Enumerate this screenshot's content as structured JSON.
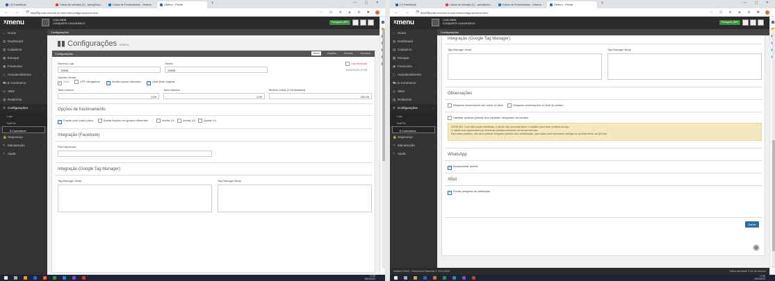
{
  "browser": {
    "tabs": [
      {
        "label": "(7) Facebook",
        "color": "#3b5998"
      },
      {
        "label": "Caixa de entrada (7) - adm@nuv...",
        "color": "#d44638"
      },
      {
        "label": "Caixa de Ferramentas - Xmenu",
        "color": "#2b6cb0"
      },
      {
        "label": "XMenu - Portal",
        "color": "#2b6cb0"
      }
    ],
    "url": "https://portal.netcontroll.com.br/#/configuracoes/xmenu",
    "window_controls": "— ▢ ✕",
    "nav_buttons": "← → ⟳ ⌂"
  },
  "header": {
    "logo_x": "X",
    "logo_text": "menu",
    "store_line1": "LOJA 19838",
    "store_line2": "CONQUISTE LOJA MODELO",
    "language": "Português (BR)"
  },
  "sidebar": {
    "items": [
      {
        "icon": "⌂",
        "label": "Home"
      },
      {
        "icon": "▥",
        "label": "Dashboard"
      },
      {
        "icon": "▤",
        "label": "Cadastros"
      },
      {
        "icon": "▦",
        "label": "Estoque"
      },
      {
        "icon": "▣",
        "label": "Financeiro"
      },
      {
        "icon": "◻",
        "label": "Autoatendimento"
      },
      {
        "icon": "⛟",
        "label": "E-Commerce"
      },
      {
        "icon": "◎",
        "label": "XBot"
      },
      {
        "icon": "▧",
        "label": "Relatórios"
      },
      {
        "icon": "⚙",
        "label": "Configurações"
      }
    ],
    "sub_items": [
      "Loja",
      "NotFiIs",
      "E-Commerce"
    ],
    "bottom_items": [
      {
        "icon": "🔒",
        "label": "Segurança"
      },
      {
        "icon": "✎",
        "label": "Manutenção"
      },
      {
        "icon": "?",
        "label": "Ajuda"
      }
    ]
  },
  "section_header": "Configurações",
  "left": {
    "page_title": "Configurações",
    "page_subtitle": "XMenu",
    "panel_title": "Configurações",
    "panel_tabs": [
      "Geral",
      "Opções",
      "Vendas",
      "Horários"
    ],
    "numero_loja_label": "Número Loja",
    "numero_loja_value": "19838",
    "senha_label": "Senha",
    "senha_value": "19838",
    "loja_fechada_label": "Loja fechada",
    "loja_fechada_date": "10/01/2018 10:58",
    "opcoes_venda_label": "Opções Venda",
    "cb_todo": "Todo",
    "cb_cpf": "CPF Obrigatório",
    "cb_cupom": "Aceita cupom desconto",
    "cb_texto": "Usar texto original",
    "taxa_minima_label": "Taxa mínima",
    "taxa_minima_value": "0.00",
    "taxa_maxima_label": "Taxa máxima",
    "taxa_maxima_value": "0.00",
    "minimo_label": "Mínimo online (0.00 ilimitado)",
    "minimo_value": "200.00",
    "fracionamento_title": "Opções de fracionamento",
    "cb_fracao": "Fração pelo maior preço",
    "cb_grupos": "Aceita frações em grupos diferentes",
    "cb_12": "Aceita 1/2",
    "cb_13": "Aceita 1/3",
    "cb_14": "Aceita 1/4",
    "facebook_title": "Integração (Facebook)",
    "pixel_label": "Pixel facebook",
    "gtm_title": "Integração (Google Tag Manager)",
    "gtm_head_label": "Tag Manager Head",
    "gtm_body_label": "Tag Manager Body"
  },
  "right": {
    "gtm_title": "Integração (Google Tag Manager)",
    "gtm_head_label": "Tag Manager Head",
    "gtm_body_label": "Tag Manager Body",
    "obs_title": "Observações",
    "cb_obs_item": "Disquear observações em todos os itens",
    "cb_obs_final": "Disquear observações no final do pedido",
    "cb_habilitar": "Habilitar pedidos (Mesa) sem cadastro obrigatório do usuário",
    "warn_line1": "ATENÇÃO: Com esta opção habilitada, o cliente não precisará fazer o cadastro para fazer pedidos na loja.",
    "warn_line2": "O lojista será responsável por eventuais pedidos efetuados de forma indevida.",
    "warn_line3": "Para estes pedidos, não será possível bloquear pedidos sem identificação, para estes será necessário desligar os pedidos feitos via QrCode.",
    "whatsapp_title": "WhatsApp",
    "cb_acompanhar": "Acompanhar pedido",
    "xbot_title": "XBot",
    "cb_pesquisa": "Enviar pesquisa de satisfação",
    "save_label": "Salvar",
    "footer_left": "NetMet ©2003 - Netcontroll Sistemas © 2012-2023",
    "footer_right": "Última atividade © há 28 minutos"
  },
  "taskbar": {
    "time": "17:40",
    "date": "15/01/2023",
    "lang": "POR PTB2"
  },
  "colors": {
    "accent": "#2b6cb0",
    "header_bg": "#2b2b2b",
    "sidebar_bg": "#333333",
    "lang_green": "#3c8d40",
    "warn_bg": "#f4e8c1"
  }
}
